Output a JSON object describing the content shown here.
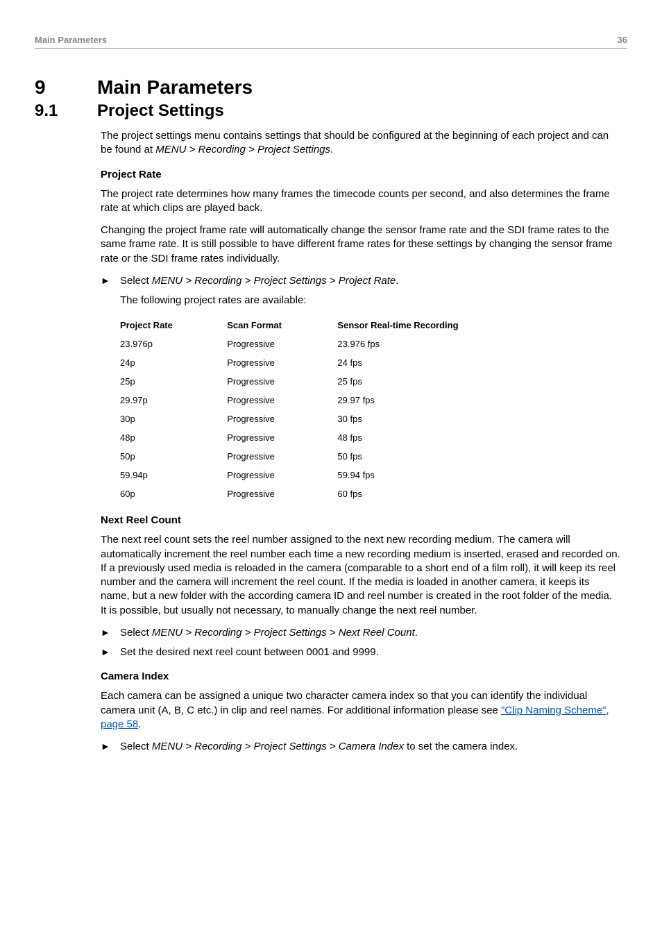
{
  "header": {
    "title": "Main Parameters",
    "page_number": "36"
  },
  "chapter": {
    "number": "9",
    "title": "Main Parameters"
  },
  "section": {
    "number": "9.1",
    "title": "Project Settings",
    "intro": "The project settings menu contains settings that should be configured at the beginning of each project and can be found at ",
    "intro_path": "MENU > Recording > Project Settings",
    "intro_end": "."
  },
  "project_rate": {
    "heading": "Project Rate",
    "p1": "The project rate determines how many frames the timecode counts per second, and also determines the frame rate at which clips are played back.",
    "p2": "Changing the project frame rate will automatically change the sensor frame rate and the SDI frame rates to the same frame rate. It is still possible to have different frame rates for these settings by changing the sensor frame rate or the SDI frame rates individually.",
    "bullet_prefix": "Select ",
    "bullet_path": "MENU > Recording > Project Settings > Project Rate",
    "bullet_suffix": ".",
    "available_text": "The following project rates are available:",
    "table": {
      "headers": [
        "Project Rate",
        "Scan Format",
        "Sensor Real-time Recording"
      ],
      "rows": [
        [
          "23.976p",
          "Progressive",
          "23.976 fps"
        ],
        [
          "24p",
          "Progressive",
          "24 fps"
        ],
        [
          "25p",
          "Progressive",
          "25 fps"
        ],
        [
          "29.97p",
          "Progressive",
          "29.97 fps"
        ],
        [
          "30p",
          "Progressive",
          "30 fps"
        ],
        [
          "48p",
          "Progressive",
          "48 fps"
        ],
        [
          "50p",
          "Progressive",
          "50 fps"
        ],
        [
          "59.94p",
          "Progressive",
          "59.94 fps"
        ],
        [
          "60p",
          "Progressive",
          "60 fps"
        ]
      ]
    }
  },
  "next_reel": {
    "heading": "Next Reel Count",
    "p1": "The next reel count sets the reel number assigned to the next new recording medium. The camera will automatically increment the reel number each time a new recording medium is inserted, erased and recorded on. If a previously used media is reloaded in the camera (comparable to a short end of a film roll), it will keep its reel number and the camera will increment the reel count. If the media is loaded in another camera, it keeps its name, but a new folder with the according camera ID and reel number is created in the root folder of the media. It is possible, but usually not necessary, to manually change the next reel number.",
    "bullet1_prefix": "Select ",
    "bullet1_path": "MENU > Recording > Project Settings > Next Reel Count",
    "bullet1_suffix": ".",
    "bullet2": "Set the desired next reel count between 0001 and 9999."
  },
  "camera_index": {
    "heading": "Camera Index",
    "p1_prefix": "Each camera can be assigned a unique two character camera index so that you can identify the individual camera unit (A, B, C etc.) in clip and reel names. For additional information please see ",
    "link_text": "\"Clip Naming Scheme\", page 58",
    "p1_suffix": ".",
    "bullet_prefix": "Select ",
    "bullet_path": "MENU > Recording > Project Settings > Camera Index",
    "bullet_suffix": " to set the camera index."
  }
}
